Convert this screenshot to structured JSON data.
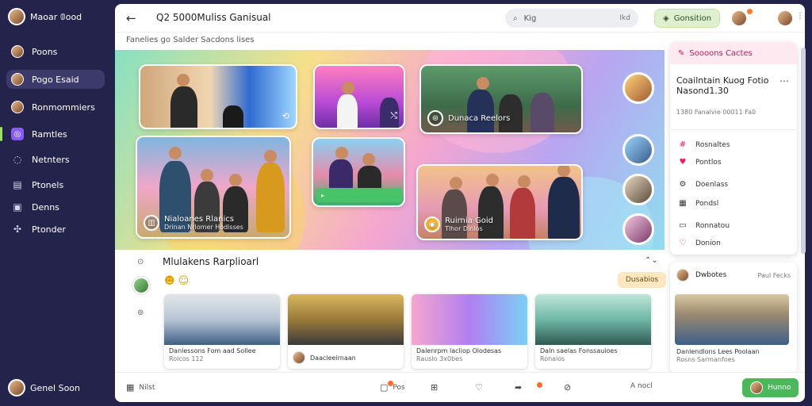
{
  "sidebar": {
    "profile_name": "Maoar 𝟘ood",
    "items": [
      {
        "label": "Poons",
        "icon": "user-avatar-icon"
      },
      {
        "label": "Pogo Esaid",
        "icon": "user-avatar-icon"
      },
      {
        "label": "Ronmommiers",
        "icon": "user-avatar-icon"
      },
      {
        "label": "Ramtles",
        "icon": "instagram-icon"
      },
      {
        "label": "Netnters",
        "icon": "chat-bubble-icon"
      },
      {
        "label": "Ptonels",
        "icon": "document-icon"
      },
      {
        "label": "Denns",
        "icon": "save-icon"
      },
      {
        "label": "Ptonder",
        "icon": "puzzle-icon"
      }
    ],
    "bottom_name": "Genel Soon"
  },
  "topbar": {
    "title": "Q2 5000Muliss Ganisual",
    "search_text": "Kig",
    "search_kbd": "Ikd",
    "action_label": "Gonsition"
  },
  "subtitle": "Fanelies go Salder Sacdons lises",
  "hero": {
    "cards": [
      {
        "label": "Nialoanes Rlanics",
        "sub": "Drinan Nrlomer Hodisses"
      },
      {
        "label": "Dunaca Reelors",
        "sub": ""
      },
      {
        "label": "Ruirnia Goid",
        "sub": "Tlhor Dinlos"
      },
      {
        "label": "",
        "sub": ""
      },
      {
        "label": "",
        "sub": ""
      },
      {
        "label": "",
        "sub": ""
      }
    ]
  },
  "right_panel": {
    "header": "Soooons Cactes",
    "title": "Coailntain Kuog Fotio Nasond1.30",
    "meta": "1380 Fanalvie 00011 Fa0",
    "items": [
      {
        "label": "Rosnaltes",
        "icon": "hashtag-icon"
      },
      {
        "label": "Pontlos",
        "icon": "heart-icon"
      },
      {
        "label": "Doenlass",
        "icon": "gear-icon"
      },
      {
        "label": "Pondsl",
        "icon": "calendar-icon"
      },
      {
        "label": "Ronnatou",
        "icon": "box-icon"
      },
      {
        "label": "Donion",
        "icon": "heart-outline-icon"
      }
    ]
  },
  "lower": {
    "title": "Mlulakens Rarplioarl",
    "chip": "Dusabios",
    "videos": [
      {
        "title": "Danlessons Fom aad Sollee",
        "meta": "Rolcos 112"
      },
      {
        "title": "Daacleeirnaan",
        "meta": ""
      },
      {
        "title": "Dalenrpm lacliop Olodesas",
        "meta": "Rauslo 3x0bes"
      },
      {
        "title": "Daln saelas Fonssauioes",
        "meta": "Ronaios"
      }
    ],
    "side_card": {
      "author": "Dwbotes",
      "meta": "Paul Fecks",
      "title": "Danlendlons Lees Poolaan",
      "sub": "Rosns Sarmanfoes"
    }
  },
  "bottombar": {
    "left_text": "Nilst",
    "comments_text": "Pos",
    "right_text": "A nocl",
    "green_label": "Hunno"
  }
}
